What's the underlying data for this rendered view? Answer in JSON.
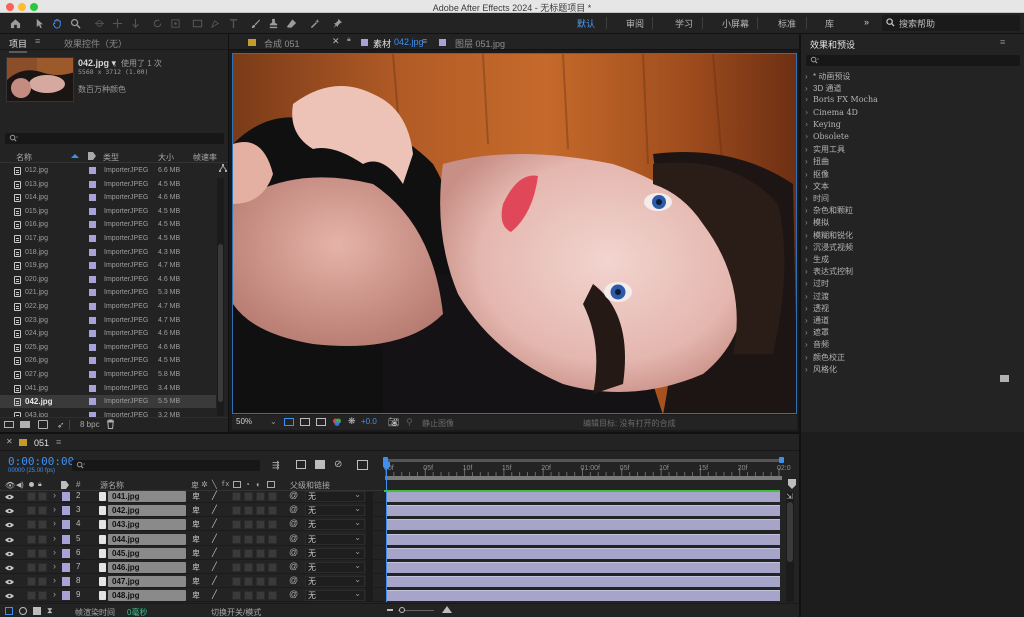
{
  "window": {
    "title": "Adobe After Effects 2024 - 无标题项目 *"
  },
  "workspaces": [
    {
      "label": "默认",
      "active": true
    },
    {
      "label": "审阅",
      "active": false
    },
    {
      "label": "学习",
      "active": false
    },
    {
      "label": "小屏幕",
      "active": false
    },
    {
      "label": "标准",
      "active": false
    },
    {
      "label": "库",
      "active": false
    }
  ],
  "toolbar": {
    "more": "»",
    "search_placeholder": "搜索帮助"
  },
  "project": {
    "tab_project": "项目",
    "tab_effects": "效果控件（无）",
    "selected_name": "042.jpg ▾",
    "usage": "，使用了 1 次",
    "dimensions": "5568 x 3712 (1.00)",
    "color_info": "数百万种颜色",
    "columns": {
      "name": "名称",
      "type": "类型",
      "size": "大小",
      "framerate": "帧速率"
    },
    "rows": [
      {
        "name": "012.jpg",
        "type": "ImporterJPEG",
        "size": "6.6 MB"
      },
      {
        "name": "013.jpg",
        "type": "ImporterJPEG",
        "size": "4.5 MB"
      },
      {
        "name": "014.jpg",
        "type": "ImporterJPEG",
        "size": "4.6 MB"
      },
      {
        "name": "015.jpg",
        "type": "ImporterJPEG",
        "size": "4.5 MB"
      },
      {
        "name": "016.jpg",
        "type": "ImporterJPEG",
        "size": "4.5 MB"
      },
      {
        "name": "017.jpg",
        "type": "ImporterJPEG",
        "size": "4.5 MB"
      },
      {
        "name": "018.jpg",
        "type": "ImporterJPEG",
        "size": "4.3 MB"
      },
      {
        "name": "019.jpg",
        "type": "ImporterJPEG",
        "size": "4.7 MB"
      },
      {
        "name": "020.jpg",
        "type": "ImporterJPEG",
        "size": "4.6 MB"
      },
      {
        "name": "021.jpg",
        "type": "ImporterJPEG",
        "size": "5.3 MB"
      },
      {
        "name": "022.jpg",
        "type": "ImporterJPEG",
        "size": "4.7 MB"
      },
      {
        "name": "023.jpg",
        "type": "ImporterJPEG",
        "size": "4.7 MB"
      },
      {
        "name": "024.jpg",
        "type": "ImporterJPEG",
        "size": "4.6 MB"
      },
      {
        "name": "025.jpg",
        "type": "ImporterJPEG",
        "size": "4.6 MB"
      },
      {
        "name": "026.jpg",
        "type": "ImporterJPEG",
        "size": "4.5 MB"
      },
      {
        "name": "027.jpg",
        "type": "ImporterJPEG",
        "size": "5.8 MB"
      },
      {
        "name": "041.jpg",
        "type": "ImporterJPEG",
        "size": "3.4 MB"
      },
      {
        "name": "042.jpg",
        "type": "ImporterJPEG",
        "size": "5.5 MB",
        "selected": true
      },
      {
        "name": "043.jpg",
        "type": "ImporterJPEG",
        "size": "3.2 MB"
      }
    ],
    "bpc": "8 bpc"
  },
  "viewer": {
    "tab_comp": "合成 051",
    "tab_footage": "素材",
    "tab_footage_name": "042.jpg",
    "tab_layer": "图层 051.jpg",
    "zoom": "50%",
    "exposure": "+0.0",
    "status_left": "静止图像",
    "status_right": "编辑目标: 没有打开的合成"
  },
  "effects": {
    "title": "效果和预设",
    "items": [
      "* 动画预设",
      "3D 通道",
      "Boris FX Mocha",
      "Cinema 4D",
      "Keying",
      "Obsolete",
      "实用工具",
      "扭曲",
      "抠像",
      "文本",
      "时间",
      "杂色和颗粒",
      "模拟",
      "模糊和锐化",
      "沉浸式视频",
      "生成",
      "表达式控制",
      "过时",
      "过渡",
      "透视",
      "通道",
      "遮罩",
      "音频",
      "颜色校正",
      "风格化"
    ]
  },
  "timeline": {
    "tab": "051",
    "timecode": "0:00:00:00",
    "timecode_sub": "00000 (25.00 fps)",
    "col_num": "#",
    "col_source": "源名称",
    "col_parent": "父级和链接",
    "ruler": [
      "00f",
      "05f",
      "10f",
      "15f",
      "20f",
      "01:00f",
      "05f",
      "10f",
      "15f",
      "20f",
      "02:0"
    ],
    "layers": [
      {
        "num": "2",
        "name": "041.jpg",
        "parent": "无"
      },
      {
        "num": "3",
        "name": "042.jpg",
        "parent": "无"
      },
      {
        "num": "4",
        "name": "043.jpg",
        "parent": "无"
      },
      {
        "num": "5",
        "name": "044.jpg",
        "parent": "无"
      },
      {
        "num": "6",
        "name": "045.jpg",
        "parent": "无"
      },
      {
        "num": "7",
        "name": "046.jpg",
        "parent": "无"
      },
      {
        "num": "8",
        "name": "047.jpg",
        "parent": "无"
      },
      {
        "num": "9",
        "name": "048.jpg",
        "parent": "无"
      }
    ],
    "footer_render": "帧渲染时间",
    "footer_render_value": "0毫秒",
    "footer_toggle": "切换开关/模式"
  },
  "colors": {
    "accent": "#3f8ff0",
    "label_lavender": "#a7a3d8",
    "timecode": "#3f8ff0",
    "workarea_green": "#3fbf3f"
  }
}
